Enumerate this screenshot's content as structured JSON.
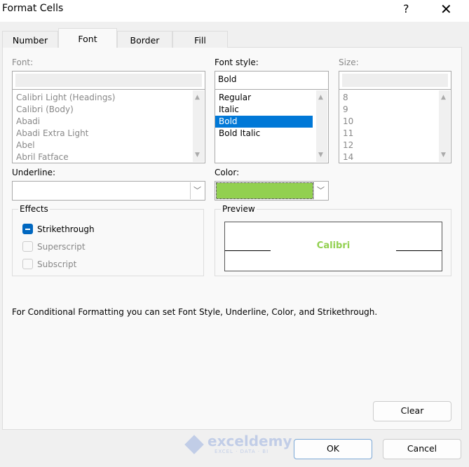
{
  "window": {
    "title": "Format Cells",
    "help_label": "?",
    "close_label": "✕"
  },
  "tabs": [
    {
      "label": "Number"
    },
    {
      "label": "Font"
    },
    {
      "label": "Border"
    },
    {
      "label": "Fill"
    }
  ],
  "font": {
    "label": "Font:",
    "value": "",
    "items": [
      "Calibri Light (Headings)",
      "Calibri (Body)",
      "Abadi",
      "Abadi Extra Light",
      "Abel",
      "Abril Fatface"
    ]
  },
  "font_style": {
    "label": "Font style:",
    "value": "Bold",
    "items": [
      "Regular",
      "Italic",
      "Bold",
      "Bold Italic"
    ],
    "selected": "Bold"
  },
  "size": {
    "label": "Size:",
    "value": "",
    "items": [
      "8",
      "9",
      "10",
      "11",
      "12",
      "14"
    ]
  },
  "underline": {
    "label": "Underline:",
    "value": ""
  },
  "color": {
    "label": "Color:",
    "value": "#92d050"
  },
  "effects": {
    "label": "Effects",
    "strikethrough": {
      "label": "Strikethrough",
      "state": "indeterminate"
    },
    "superscript": {
      "label": "Superscript",
      "checked": false
    },
    "subscript": {
      "label": "Subscript",
      "checked": false
    }
  },
  "preview": {
    "label": "Preview",
    "sample": "Calibri",
    "sample_color": "#92d050"
  },
  "note": "For Conditional Formatting you can set Font Style, Underline, Color, and Strikethrough.",
  "buttons": {
    "clear": "Clear",
    "ok": "OK",
    "cancel": "Cancel"
  },
  "watermark": {
    "brand": "exceldemy",
    "tagline": "EXCEL · DATA · BI"
  },
  "colors": {
    "selection": "#0078d7",
    "checkbox": "#0067c0"
  }
}
